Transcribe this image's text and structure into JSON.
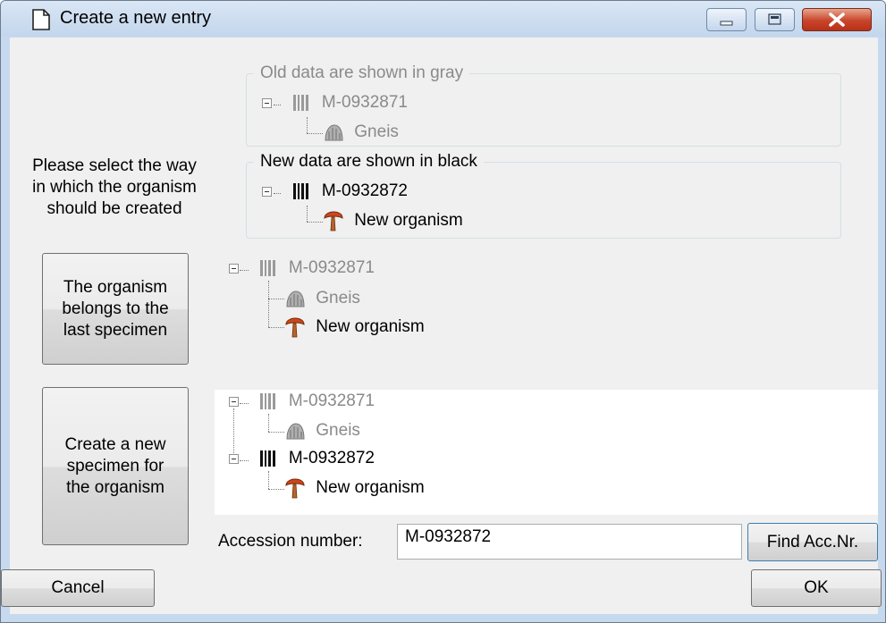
{
  "window": {
    "title": "Create a new entry"
  },
  "old_group": {
    "legend": "Old data are shown in gray",
    "specimen": "M-0932871",
    "organism": "Gneis"
  },
  "new_group": {
    "legend": "New data are shown in black",
    "specimen": "M-0932872",
    "organism": "New organism"
  },
  "instruction": "Please select the way in which the organism should be created",
  "option_last": {
    "button": "The organism belongs to the last specimen",
    "tree": {
      "specimen": "M-0932871",
      "organism_old": "Gneis",
      "organism_new": "New organism"
    }
  },
  "option_new": {
    "button": "Create a new specimen for the organism",
    "tree": {
      "specimen_old": "M-0932871",
      "organism_old": "Gneis",
      "specimen_new": "M-0932872",
      "organism_new": "New organism"
    }
  },
  "accession": {
    "label": "Accession number:",
    "value": "M-0932872",
    "find_button": "Find Acc.Nr."
  },
  "footer": {
    "cancel": "Cancel",
    "ok": "OK"
  },
  "icons": {
    "title": "document-icon",
    "minimize": "minimize-icon",
    "maximize": "maximize-icon",
    "close": "close-icon",
    "specimen": "barcode-icon",
    "rock": "rock-icon",
    "organism": "mushroom-icon"
  }
}
